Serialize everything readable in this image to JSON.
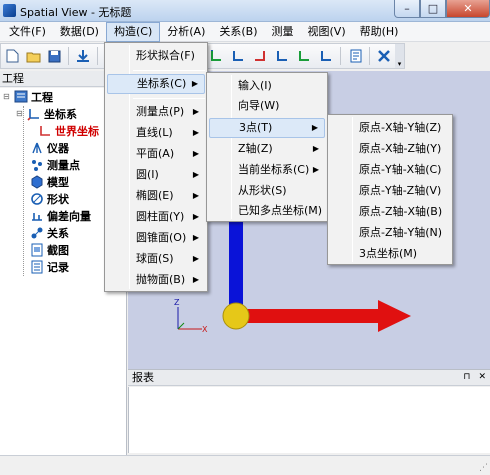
{
  "window": {
    "title": "Spatial View - 无标题",
    "minimize": "–",
    "maximize": "□",
    "close": "✕"
  },
  "menubar": [
    {
      "label": "文件(F)"
    },
    {
      "label": "数据(D)"
    },
    {
      "label": "构造(C)"
    },
    {
      "label": "分析(A)"
    },
    {
      "label": "关系(B)"
    },
    {
      "label": "测量"
    },
    {
      "label": "视图(V)"
    },
    {
      "label": "帮助(H)"
    }
  ],
  "toolbar": {
    "overflow": "▾"
  },
  "project_panel": {
    "title": "工程",
    "pin": "⊓",
    "items": [
      {
        "label": "工程"
      },
      {
        "label": "坐标系"
      },
      {
        "label": "世界坐标"
      },
      {
        "label": "仪器"
      },
      {
        "label": "测量点"
      },
      {
        "label": "模型"
      },
      {
        "label": "形状"
      },
      {
        "label": "偏差向量"
      },
      {
        "label": "关系"
      },
      {
        "label": "截图"
      },
      {
        "label": "记录"
      }
    ]
  },
  "viewport": {
    "axis_z": "Z",
    "axis_x": "X"
  },
  "report_panel": {
    "title": "报表",
    "pin": "⊓",
    "close": "✕"
  },
  "construct_menu": {
    "items": [
      {
        "label": "形状拟合(F)"
      },
      {
        "label": "坐标系(C)"
      },
      {
        "label": "测量点(P)"
      },
      {
        "label": "直线(L)"
      },
      {
        "label": "平面(A)"
      },
      {
        "label": "圆(I)"
      },
      {
        "label": "椭圆(E)"
      },
      {
        "label": "圆柱面(Y)"
      },
      {
        "label": "圆锥面(O)"
      },
      {
        "label": "球面(S)"
      },
      {
        "label": "抛物面(B)"
      }
    ]
  },
  "coord_menu": {
    "items": [
      {
        "label": "输入(I)"
      },
      {
        "label": "向导(W)"
      },
      {
        "label": "3点(T)"
      },
      {
        "label": "Z轴(Z)"
      },
      {
        "label": "当前坐标系(C)"
      },
      {
        "label": "从形状(S)"
      },
      {
        "label": "已知多点坐标(M)"
      }
    ]
  },
  "three_point_menu": {
    "items": [
      {
        "label": "原点-X轴-Y轴(Z)"
      },
      {
        "label": "原点-X轴-Z轴(Y)"
      },
      {
        "label": "原点-Y轴-X轴(C)"
      },
      {
        "label": "原点-Y轴-Z轴(V)"
      },
      {
        "label": "原点-Z轴-X轴(B)"
      },
      {
        "label": "原点-Z轴-Y轴(N)"
      },
      {
        "label": "3点坐标(M)"
      }
    ]
  }
}
